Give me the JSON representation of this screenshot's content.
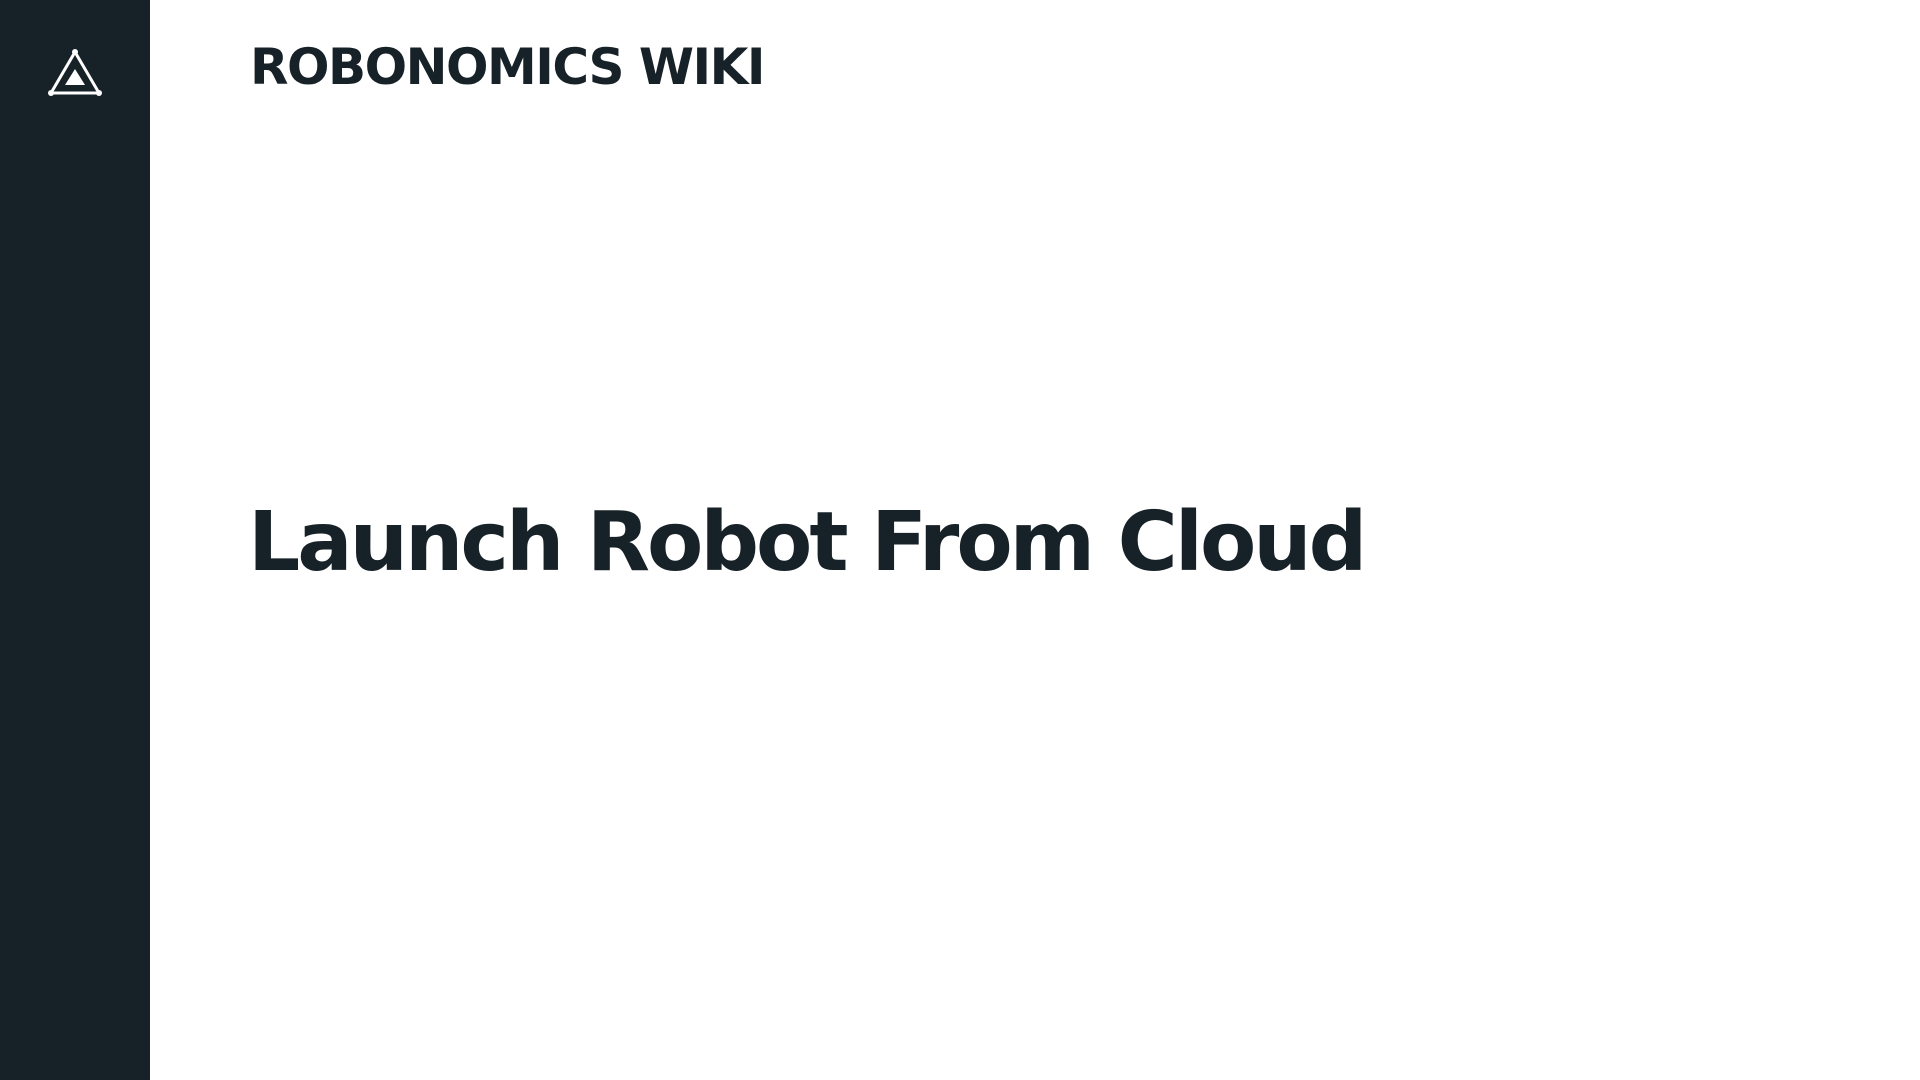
{
  "header": {
    "site_title": "ROBONOMICS WIKI"
  },
  "main": {
    "page_title": "Launch Robot From Cloud"
  },
  "icons": {
    "logo": "robonomics-triangle-logo-icon"
  },
  "colors": {
    "sidebar_background": "#172128",
    "text": "#172128",
    "page_background": "#ffffff",
    "logo_stroke": "#ffffff"
  }
}
